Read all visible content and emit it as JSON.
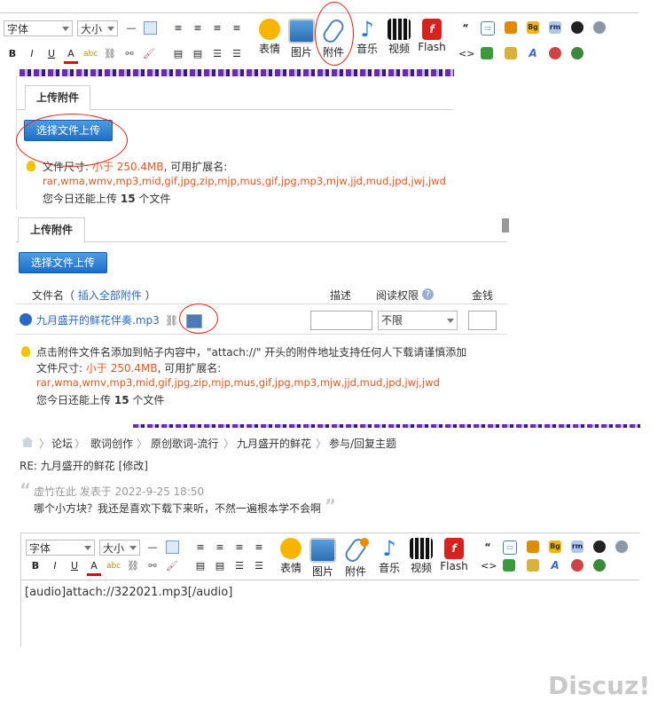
{
  "editor_top": {
    "font_select": "字体",
    "size_select": "大小",
    "big_buttons": [
      {
        "label": "表情",
        "icon": "smiley-icon"
      },
      {
        "label": "图片",
        "icon": "image-icon"
      },
      {
        "label": "附件",
        "icon": "paperclip-icon"
      },
      {
        "label": "音乐",
        "icon": "music-note-icon"
      },
      {
        "label": "视频",
        "icon": "video-clapper-icon"
      },
      {
        "label": "Flash",
        "icon": "flash-icon"
      }
    ],
    "small_row1": [
      "—"
    ],
    "small_row2": [
      "B",
      "I",
      "U",
      "A"
    ]
  },
  "upload_panel_1": {
    "tab_label": "上传附件",
    "button_label": "选择文件上传",
    "size_label": "文件尺寸:",
    "size_value": "小于 250.4MB",
    "ext_label": ", 可用扩展名:",
    "extensions": "rar,wma,wmv,mp3,mid,gif,jpg,zip,mjp,mus,gif,jpg,mp3,mjw,jjd,mud,jpd,jwj,jwd",
    "remaining_prefix": "您今日还能上传",
    "remaining_count": "15",
    "remaining_suffix": "个文件"
  },
  "upload_panel_2": {
    "tab_label": "上传附件",
    "button_label": "选择文件上传",
    "table_headers": {
      "filename": "文件名",
      "insert_all": "插入全部附件",
      "description": "描述",
      "permission": "阅读权限",
      "price": "金钱"
    },
    "file_row": {
      "name": "九月盛开的鲜花伴奏.mp3",
      "permission_value": "不限"
    },
    "tip": "点击附件文件名添加到帖子内容中，\"attach://\" 开头的附件地址支持任何人下载请谨慎添加",
    "size_label": "文件尺寸:",
    "size_value": "小于 250.4MB",
    "ext_label": ", 可用扩展名:",
    "extensions": "rar,wma,wmv,mp3,mid,gif,jpg,zip,mjp,mus,gif,jpg,mp3,mjw,jjd,mud,jpd,jwj,jwd",
    "remaining_prefix": "您今日还能上传",
    "remaining_count": "15",
    "remaining_suffix": "个文件"
  },
  "breadcrumb": [
    "论坛",
    "歌词创作",
    "原创歌词-流行",
    "九月盛开的鲜花",
    "参与/回复主题"
  ],
  "reply": {
    "title": "RE: 九月盛开的鲜花 [修改]",
    "quote_header": "虚竹在此 发表于 2022-9-25 18:50",
    "quote_body": "哪个小方块？我还是喜欢下载下来听，不然一遍根本学不会啊"
  },
  "editor_bottom": {
    "font_select": "字体",
    "size_select": "大小",
    "big_buttons": [
      "表情",
      "图片",
      "附件",
      "音乐",
      "视频",
      "Flash"
    ],
    "content": "[audio]attach://322021.mp3[/audio]"
  },
  "watermark": "Discuz!",
  "colors": {
    "accent_red": "#e8541e",
    "button_blue": "#2a7ad0",
    "annotation_red": "#d21111"
  }
}
